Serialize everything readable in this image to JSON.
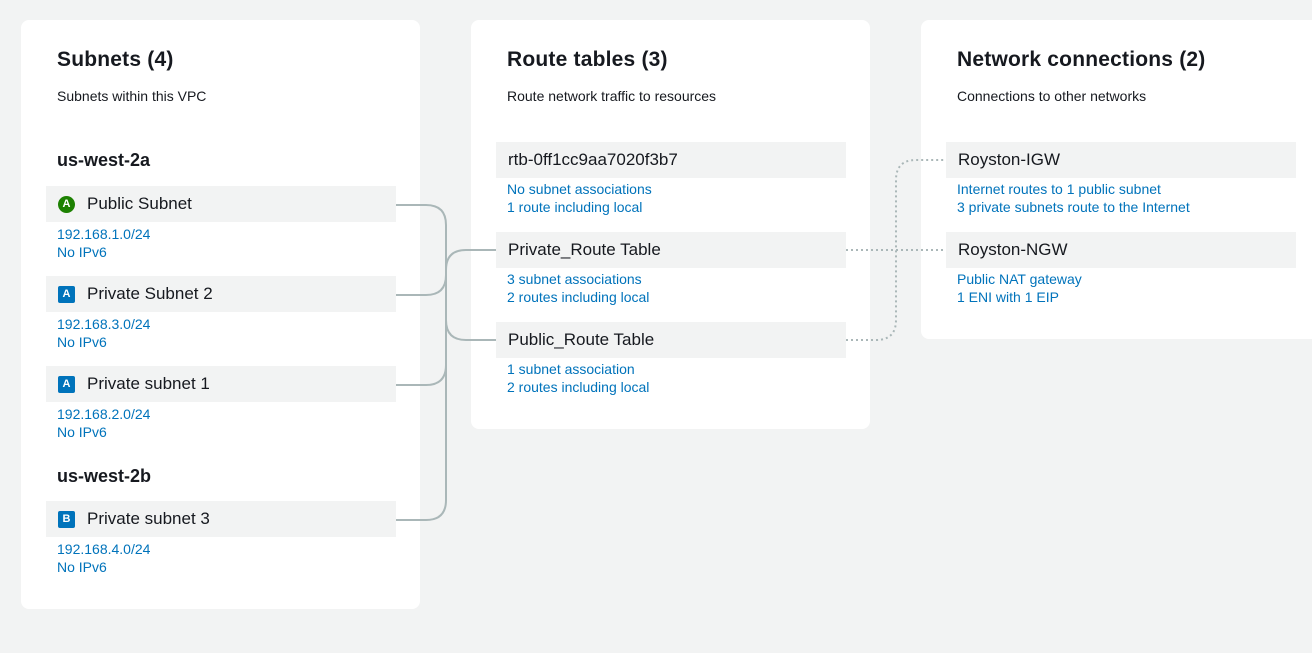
{
  "colors": {
    "page_background": "#f2f3f3",
    "card_background": "#ffffff",
    "node_background": "#f2f3f3",
    "link": "#0073bb",
    "text": "#16191f",
    "connector": "#aab7b8",
    "badge_public": "#1d8102",
    "badge_private": "#0073bb"
  },
  "subnets": {
    "title": "Subnets (4)",
    "subtitle": "Subnets within this VPC",
    "zones": [
      {
        "name": "us-west-2a",
        "items": [
          {
            "badge": "A",
            "badge_shape": "circle",
            "name": "Public Subnet",
            "cidr": "192.168.1.0/24",
            "ipv6": "No IPv6"
          },
          {
            "badge": "A",
            "badge_shape": "square",
            "name": "Private Subnet 2",
            "cidr": "192.168.3.0/24",
            "ipv6": "No IPv6"
          },
          {
            "badge": "A",
            "badge_shape": "square",
            "name": "Private subnet 1",
            "cidr": "192.168.2.0/24",
            "ipv6": "No IPv6"
          }
        ]
      },
      {
        "name": "us-west-2b",
        "items": [
          {
            "badge": "B",
            "badge_shape": "square",
            "name": "Private subnet 3",
            "cidr": "192.168.4.0/24",
            "ipv6": "No IPv6"
          }
        ]
      }
    ]
  },
  "route_tables": {
    "title": "Route tables (3)",
    "subtitle": "Route network traffic to resources",
    "items": [
      {
        "name": "rtb-0ff1cc9aa7020f3b7",
        "associations": "No subnet associations",
        "routes": "1 route including local"
      },
      {
        "name": "Private_Route Table",
        "associations": "3 subnet associations",
        "routes": "2 routes including local"
      },
      {
        "name": "Public_Route Table",
        "associations": "1 subnet association",
        "routes": "2 routes including local"
      }
    ]
  },
  "network_connections": {
    "title": "Network connections (2)",
    "subtitle": "Connections to other networks",
    "items": [
      {
        "name": "Royston-IGW",
        "line1": "Internet routes to 1 public subnet",
        "line2": "3 private subnets route to the Internet"
      },
      {
        "name": "Royston-NGW",
        "line1": "Public NAT gateway",
        "line2": "1 ENI with 1 EIP"
      }
    ]
  }
}
